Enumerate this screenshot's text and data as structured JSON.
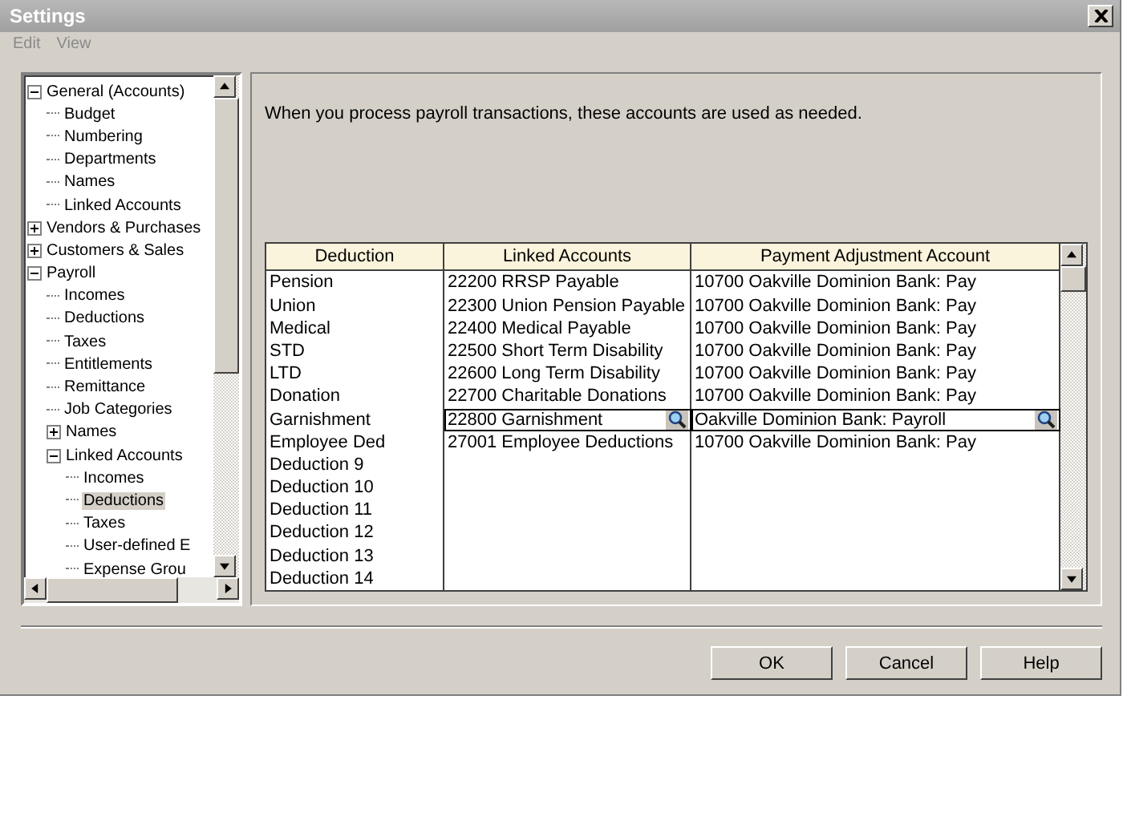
{
  "window": {
    "title": "Settings"
  },
  "menu": [
    {
      "label": "Edit",
      "disabled": true
    },
    {
      "label": "View",
      "disabled": true
    }
  ],
  "tree": [
    {
      "label": "General (Accounts)",
      "expanded": true,
      "selected": false,
      "children": [
        {
          "label": "Budget",
          "selected": false
        },
        {
          "label": "Numbering",
          "selected": false
        },
        {
          "label": "Departments",
          "selected": false
        },
        {
          "label": "Names",
          "selected": false
        },
        {
          "label": "Linked Accounts",
          "selected": false
        }
      ]
    },
    {
      "label": "Vendors & Purchases",
      "expanded": false,
      "selected": false
    },
    {
      "label": "Customers & Sales",
      "expanded": false,
      "selected": false
    },
    {
      "label": "Payroll",
      "expanded": true,
      "selected": false,
      "children": [
        {
          "label": "Incomes",
          "selected": false
        },
        {
          "label": "Deductions",
          "selected": false
        },
        {
          "label": "Taxes",
          "selected": false
        },
        {
          "label": "Entitlements",
          "selected": false
        },
        {
          "label": "Remittance",
          "selected": false
        },
        {
          "label": "Job Categories",
          "selected": false
        },
        {
          "label": "Names",
          "expanded": false,
          "selected": false
        },
        {
          "label": "Linked Accounts",
          "expanded": true,
          "selected": false,
          "children": [
            {
              "label": "Incomes",
              "selected": false
            },
            {
              "label": "Deductions",
              "selected": true
            },
            {
              "label": "Taxes",
              "selected": false
            },
            {
              "label": "User-defined E",
              "selected": false
            },
            {
              "label": "Expense Grou",
              "selected": false
            }
          ]
        }
      ]
    }
  ],
  "description": "When you process payroll transactions, these accounts are used as needed.",
  "table": {
    "columns": [
      "Deduction",
      "Linked Accounts",
      "Payment Adjustment Account"
    ],
    "rows": [
      {
        "cells": [
          "Pension",
          "22200 RRSP Payable",
          "10700 Oakville Dominion Bank: Pay"
        ],
        "editing": false
      },
      {
        "cells": [
          "Union",
          "22300 Union Pension Payable",
          "10700 Oakville Dominion Bank: Pay"
        ],
        "editing": false
      },
      {
        "cells": [
          "Medical",
          "22400 Medical Payable",
          "10700 Oakville Dominion Bank: Pay"
        ],
        "editing": false
      },
      {
        "cells": [
          "STD",
          "22500 Short Term Disability",
          "10700 Oakville Dominion Bank: Pay"
        ],
        "editing": false
      },
      {
        "cells": [
          "LTD",
          "22600 Long Term Disability",
          "10700 Oakville Dominion Bank: Pay"
        ],
        "editing": false
      },
      {
        "cells": [
          "Donation",
          "22700 Charitable Donations",
          "10700 Oakville Dominion Bank: Pay"
        ],
        "editing": false
      },
      {
        "cells": [
          "Garnishment",
          "22800 Garnishment",
          "Oakville Dominion Bank: Payroll"
        ],
        "editing": true
      },
      {
        "cells": [
          "Employee Ded",
          "27001 Employee Deductions",
          "10700 Oakville Dominion Bank: Pay"
        ],
        "editing": false
      },
      {
        "cells": [
          "Deduction 9",
          "",
          ""
        ],
        "editing": false
      },
      {
        "cells": [
          "Deduction 10",
          "",
          ""
        ],
        "editing": false
      },
      {
        "cells": [
          "Deduction 11",
          "",
          ""
        ],
        "editing": false
      },
      {
        "cells": [
          "Deduction 12",
          "",
          ""
        ],
        "editing": false
      },
      {
        "cells": [
          "Deduction 13",
          "",
          ""
        ],
        "editing": false
      },
      {
        "cells": [
          "Deduction 14",
          "",
          ""
        ],
        "editing": false
      }
    ]
  },
  "buttons": [
    "OK",
    "Cancel",
    "Help"
  ]
}
